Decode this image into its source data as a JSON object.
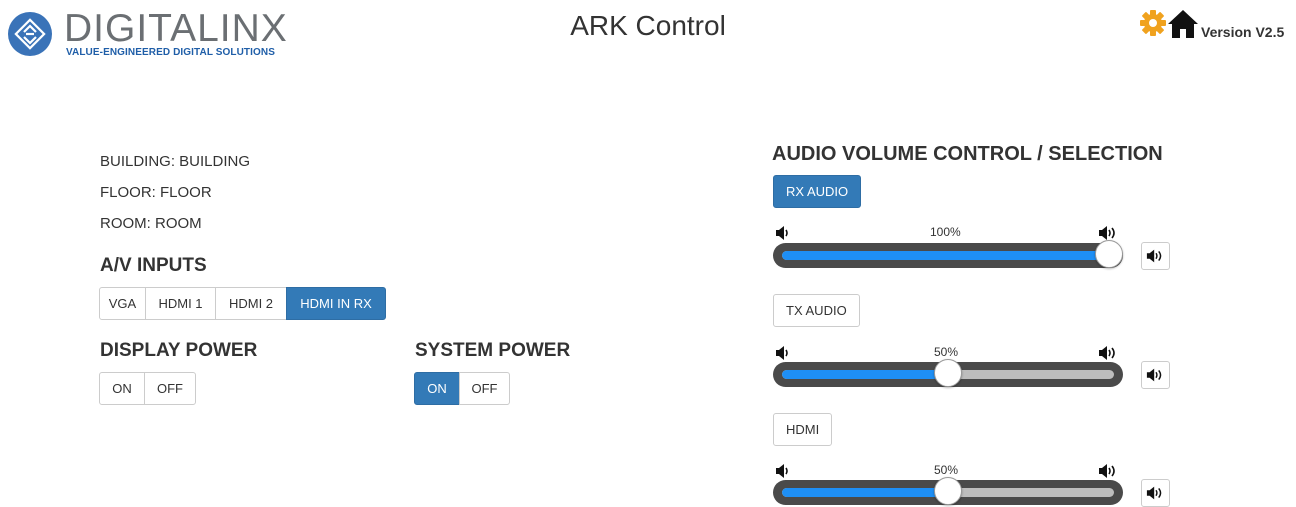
{
  "header": {
    "brand_name": "DIGITALINX",
    "brand_tagline": "VALUE-ENGINEERED DIGITAL SOLUTIONS",
    "app_title": "ARK Control",
    "version": "Version V2.5",
    "icons": [
      "logo-icon",
      "gear-icon",
      "home-icon"
    ],
    "colors": {
      "brand_blue": "#3a73b8",
      "gear": "#f0a21e"
    }
  },
  "location": {
    "building": "BUILDING: BUILDING",
    "floor": "FLOOR: FLOOR",
    "room": "ROOM: ROOM"
  },
  "av_inputs": {
    "heading": "A/V INPUTS",
    "options": [
      "VGA",
      "HDMI 1",
      "HDMI 2",
      "HDMI IN RX"
    ],
    "selected": "HDMI IN RX"
  },
  "display_power": {
    "heading": "DISPLAY POWER",
    "on_label": "ON",
    "off_label": "OFF",
    "selected": null
  },
  "system_power": {
    "heading": "SYSTEM POWER",
    "on_label": "ON",
    "off_label": "OFF",
    "selected": "ON"
  },
  "audio": {
    "heading": "AUDIO VOLUME CONTROL / SELECTION",
    "channels": [
      {
        "label": "RX AUDIO",
        "selected": true,
        "volume_label": "100%",
        "volume": 1.0
      },
      {
        "label": "TX AUDIO",
        "selected": false,
        "volume_label": "50%",
        "volume": 0.5
      },
      {
        "label": "HDMI",
        "selected": false,
        "volume_label": "50%",
        "volume": 0.5
      }
    ],
    "colors": {
      "fill": "#1e8ff5",
      "track": "#4a4a4a",
      "active_button": "#337ab7"
    }
  }
}
